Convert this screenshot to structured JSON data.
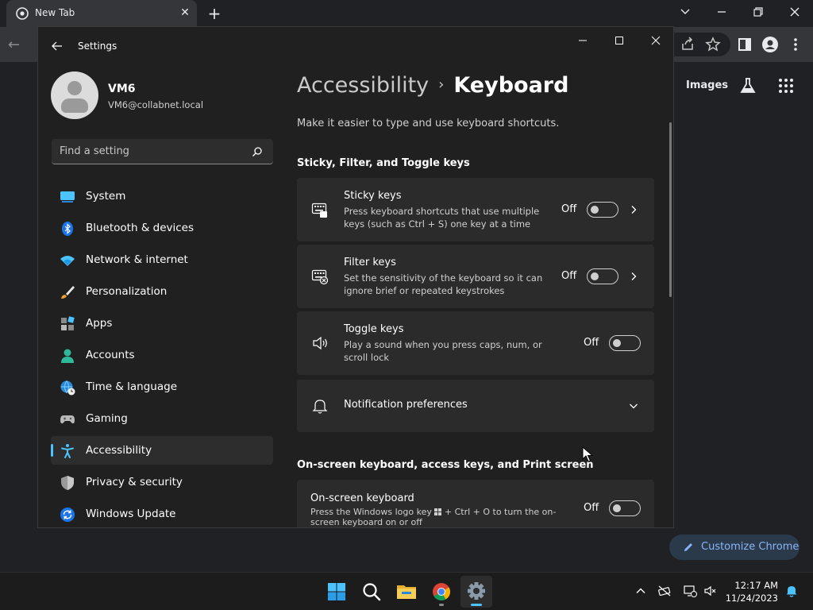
{
  "chrome": {
    "tab_title": "New Tab",
    "images_link": "Images",
    "customize_label": "Customize Chrome"
  },
  "settings": {
    "app_title": "Settings",
    "user": {
      "name": "VM6",
      "email": "VM6@collabnet.local"
    },
    "search_placeholder": "Find a setting",
    "nav": [
      {
        "label": "System",
        "icon": "system-icon"
      },
      {
        "label": "Bluetooth & devices",
        "icon": "bluetooth-icon"
      },
      {
        "label": "Network & internet",
        "icon": "wifi-icon"
      },
      {
        "label": "Personalization",
        "icon": "brush-icon"
      },
      {
        "label": "Apps",
        "icon": "apps-icon"
      },
      {
        "label": "Accounts",
        "icon": "person-icon"
      },
      {
        "label": "Time & language",
        "icon": "globe-clock-icon"
      },
      {
        "label": "Gaming",
        "icon": "gamepad-icon"
      },
      {
        "label": "Accessibility",
        "icon": "accessibility-icon",
        "active": true
      },
      {
        "label": "Privacy & security",
        "icon": "shield-icon"
      },
      {
        "label": "Windows Update",
        "icon": "update-icon"
      }
    ],
    "breadcrumb": {
      "parent": "Accessibility",
      "separator": "›",
      "current": "Keyboard"
    },
    "description": "Make it easier to type and use keyboard shortcuts.",
    "sections": {
      "sticky_filter_toggle": "Sticky, Filter, and Toggle keys",
      "onscreen": "On-screen keyboard, access keys, and Print screen"
    },
    "cards": {
      "sticky": {
        "title": "Sticky keys",
        "desc": "Press keyboard shortcuts that use multiple keys (such as Ctrl + S) one key at a time",
        "state": "Off"
      },
      "filter": {
        "title": "Filter keys",
        "desc": "Set the sensitivity of the keyboard so it can ignore brief or repeated keystrokes",
        "state": "Off"
      },
      "toggle": {
        "title": "Toggle keys",
        "desc": "Play a sound when you press caps, num, or scroll lock",
        "state": "Off"
      },
      "notifications": {
        "title": "Notification preferences"
      },
      "onscreen": {
        "title": "On-screen keyboard",
        "desc_before": "Press the Windows logo key",
        "desc_after": "+ Ctrl + O to turn the on-screen keyboard on or off",
        "state": "Off"
      }
    }
  },
  "taskbar": {
    "time": "12:17 AM",
    "date": "11/24/2023"
  },
  "colors": {
    "accent": "#4cc2ff",
    "window_bg": "#202020",
    "card_bg": "#2b2b2b"
  }
}
